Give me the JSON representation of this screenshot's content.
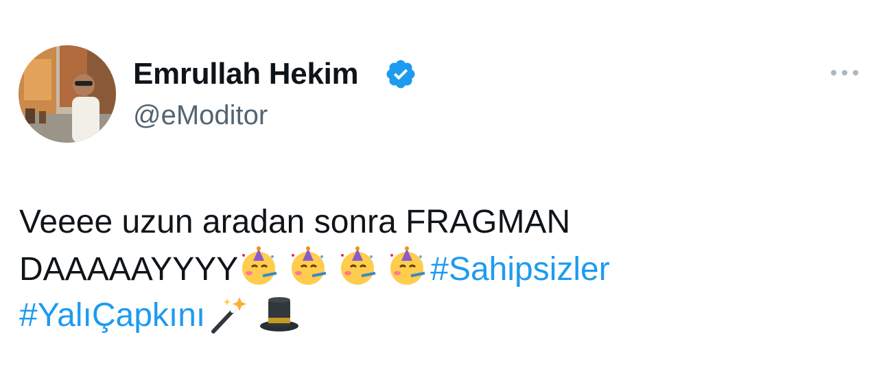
{
  "author": {
    "display_name": "Emrullah Hekim",
    "handle": "@eModitor",
    "verified": true,
    "avatar_icon": "profile-photo"
  },
  "tweet": {
    "line1": "Veeee uzun aradan sonra FRAGMAN",
    "line2_text": "DAAAAAYYYY",
    "line2_emojis": [
      "partying-face",
      "partying-face",
      "partying-face",
      "partying-face"
    ],
    "hashtag1": "#Sahipsizler",
    "hashtag2": "#YalıÇapkını",
    "line3_emojis": [
      "magic-wand",
      "top-hat"
    ]
  },
  "menu": {
    "more_icon": "more-horizontal-icon"
  },
  "colors": {
    "text": "#0f1419",
    "secondary": "#536471",
    "link": "#1d9bf0",
    "verified": "#1d9bf0"
  }
}
